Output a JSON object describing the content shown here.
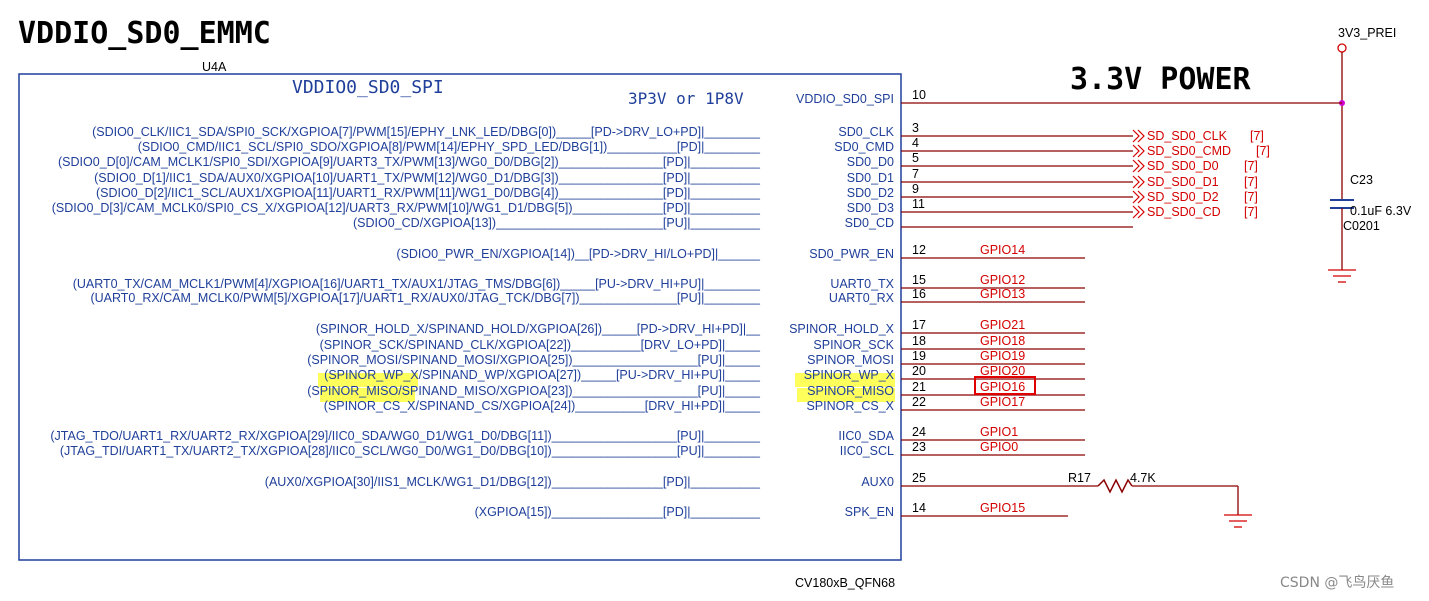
{
  "title": "VDDIO_SD0_EMMC",
  "part_ref": "U4A",
  "block_name": "VDDIO0_SD0_SPI",
  "block_voltage": "3P3V or 1P8V",
  "part_number": "CV180xB_QFN68",
  "power_label": "3.3V POWER",
  "power_net": "3V3_PREI",
  "capacitor": {
    "ref": "C23",
    "value": "0.1uF 6.3V",
    "footprint": "C0201"
  },
  "resistor": {
    "ref": "R17",
    "value": "4.7K"
  },
  "watermark": "CSDN @飞鸟厌鱼",
  "pins": [
    {
      "num": "10",
      "name": "VDDIO_SD0_SPI",
      "desc": "",
      "net": "",
      "ref": ""
    },
    {
      "num": "3",
      "name": "SD0_CLK",
      "desc": "(SDIO0_CLK/IIC1_SDA/SPI0_SCK/XGPIOA[7]/PWM[15]/EPHY_LNK_LED/DBG[0])_____[PD->DRV_LO+PD]|________",
      "net": "SD_SD0_CLK",
      "ref": "[7]"
    },
    {
      "num": "4",
      "name": "SD0_CMD",
      "desc": "(SDIO0_CMD/IIC1_SCL/SPI0_SDO/XGPIOA[8]/PWM[14]/EPHY_SPD_LED/DBG[1])__________[PD]|________",
      "net": "SD_SD0_CMD",
      "ref": "[7]"
    },
    {
      "num": "5",
      "name": "SD0_D0",
      "desc": "(SDIO0_D[0]/CAM_MCLK1/SPI0_SDI/XGPIOA[9]/UART3_TX/PWM[13]/WG0_D0/DBG[2])_______________[PD]|__________",
      "net": "SD_SD0_D0",
      "ref": "[7]"
    },
    {
      "num": "7",
      "name": "SD0_D1",
      "desc": "(SDIO0_D[1]/IIC1_SDA/AUX0/XGPIOA[10]/UART1_TX/PWM[12]/WG0_D1/DBG[3])_______________[PD]|__________",
      "net": "SD_SD0_D1",
      "ref": "[7]"
    },
    {
      "num": "9",
      "name": "SD0_D2",
      "desc": "(SDIO0_D[2]/IIC1_SCL/AUX1/XGPIOA[11]/UART1_RX/PWM[11]/WG1_D0/DBG[4])_______________[PD]|__________",
      "net": "SD_SD0_D2",
      "ref": "[7]"
    },
    {
      "num": "11",
      "name": "SD0_D3",
      "desc": "(SDIO0_D[3]/CAM_MCLK0/SPI0_CS_X/XGPIOA[12]/UART3_RX/PWM[10]/WG1_D1/DBG[5])_____________[PD]|__________",
      "net": "SD_SD0_CD",
      "ref": "[7]"
    },
    {
      "num": "",
      "name": "SD0_CD",
      "desc": "(SDIO0_CD/XGPIOA[13])________________________[PU]|__________",
      "net": "",
      "ref": ""
    },
    {
      "num": "12",
      "name": "SD0_PWR_EN",
      "desc": "(SDIO0_PWR_EN/XGPIOA[14])__[PD->DRV_HI/LO+PD]|______",
      "net": "GPIO14",
      "ref": ""
    },
    {
      "num": "15",
      "name": "UART0_TX",
      "desc": "(UART0_TX/CAM_MCLK1/PWM[4]/XGPIOA[16]/UART1_TX/AUX1/JTAG_TMS/DBG[6])_____[PU->DRV_HI+PU]|________",
      "net": "GPIO12",
      "ref": ""
    },
    {
      "num": "16",
      "name": "UART0_RX",
      "desc": "(UART0_RX/CAM_MCLK0/PWM[5]/XGPIOA[17]/UART1_RX/AUX0/JTAG_TCK/DBG[7])______________[PU]|________",
      "net": "GPIO13",
      "ref": ""
    },
    {
      "num": "17",
      "name": "SPINOR_HOLD_X",
      "desc": "(SPINOR_HOLD_X/SPINAND_HOLD/XGPIOA[26])_____[PD->DRV_HI+PD]|__",
      "net": "GPIO21",
      "ref": ""
    },
    {
      "num": "18",
      "name": "SPINOR_SCK",
      "desc": "(SPINOR_SCK/SPINAND_CLK/XGPIOA[22])__________[DRV_LO+PD]|_____",
      "net": "GPIO18",
      "ref": ""
    },
    {
      "num": "19",
      "name": "SPINOR_MOSI",
      "desc": "(SPINOR_MOSI/SPINAND_MOSI/XGPIOA[25])__________________[PU]|_____",
      "net": "GPIO19",
      "ref": ""
    },
    {
      "num": "20",
      "name": "SPINOR_WP_X",
      "desc": "(SPINOR_WP_X/SPINAND_WP/XGPIOA[27])_____[PU->DRV_HI+PU]|_____",
      "net": "GPIO20",
      "ref": ""
    },
    {
      "num": "21",
      "name": "SPINOR_MISO",
      "desc": "(SPINOR_MISO/SPINAND_MISO/XGPIOA[23])__________________[PU]|_____",
      "net": "GPIO16",
      "ref": ""
    },
    {
      "num": "22",
      "name": "SPINOR_CS_X",
      "desc": "(SPINOR_CS_X/SPINAND_CS/XGPIOA[24])__________[DRV_HI+PD]|_____",
      "net": "GPIO17",
      "ref": ""
    },
    {
      "num": "24",
      "name": "IIC0_SDA",
      "desc": "(JTAG_TDO/UART1_RX/UART2_RX/XGPIOA[29]/IIC0_SDA/WG0_D1/WG1_D0/DBG[11])__________________[PU]|________",
      "net": "GPIO1",
      "ref": ""
    },
    {
      "num": "23",
      "name": "IIC0_SCL",
      "desc": "(JTAG_TDI/UART1_TX/UART2_TX/XGPIOA[28]/IIC0_SCL/WG0_D0/WG1_D0/DBG[10])__________________[PU]|________",
      "net": "GPIO0",
      "ref": ""
    },
    {
      "num": "25",
      "name": "AUX0",
      "desc": "(AUX0/XGPIOA[30]/IIS1_MCLK/WG1_D1/DBG[12])________________[PD]|__________",
      "net": "",
      "ref": ""
    },
    {
      "num": "14",
      "name": "SPK_EN",
      "desc": "(XGPIOA[15])________________[PD]|__________",
      "net": "GPIO15",
      "ref": ""
    }
  ]
}
